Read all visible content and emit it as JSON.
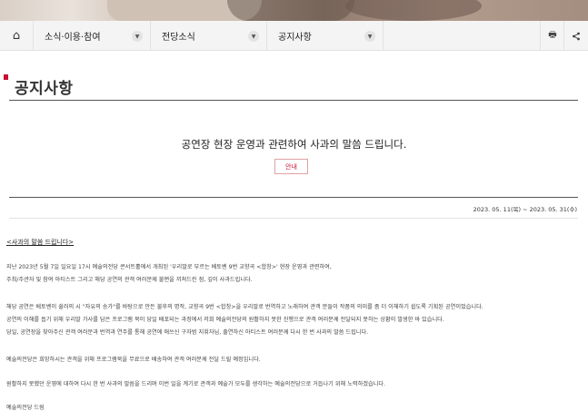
{
  "nav": {
    "home_icon": "home-icon",
    "menu1": "소식·이용·참여",
    "menu2": "전당소식",
    "menu3": "공지사항",
    "print_icon": "print-icon",
    "share_icon": "share-icon"
  },
  "page": {
    "title": "공지사항"
  },
  "notice": {
    "heading": "공연장 현장 운영과 관련하여 사과의 말씀 드립니다.",
    "category": "안내",
    "date_range": "2023. 05. 11(목) ~ 2023. 05. 31(수)",
    "body_title": "<사과의 말씀 드립니다>",
    "paragraphs": [
      "지난 2023년 5월 7일 일요일 17시 예술의전당 콘서트홀에서 개최된 '우리말로 부르는 베토벤 9번 교향곡 <합창>' 현장 운영과 관련하여,",
      "주최/주관자 및 참여 아티스트 그리고 해당 공연의 관객 여러분께 불편을 끼쳐드린 점, 깊이 사과드립니다.",
      "해당 공연은 베토벤이 쉴러의 시 \"자유의 송가\"를 바탕으로 만든 불후의 명작, 교향곡 9번 <합창>을 우리말로 번역하고 노래하여 관객 분들이 작품의 의미를 좀 더 이해하기 쉽도록 기획된 공연이었습니다.",
      "공연의 이해를 돕기 위해 우리말 가사를 담은 프로그램 북이 당일 배포되는 과정에서 저희 예술의전당의 원활하지 못한 진행으로 관객 여러분께 전달되지 못하는 상황이 발생한 바 있습니다.",
      "당일, 공연장을 찾아주신 관객 여러분과 번역과 연주를 통해 공연에 애쓰신 구자범 지휘자님, 출연하신 아티스트 여러분께 다시 한 번 사과의 말씀 드립니다.",
      "예술의전당은 희망하시는 관객을 위해 프로그램북을 무료으로 배송하여 관객 여러분께 전달 드릴 예정입니다.",
      "원활하지 못했던 운영에 대하여 다시 한 번 사과의 말씀을 드리며 이번 일을 계기로 관객과 예술가 모두를 생각하는 예술의전당으로 거듭나기 위해 노력하겠습니다.",
      "예술의전당 드림"
    ]
  },
  "colors": {
    "accent": "#c8102e",
    "nav_bg": "#f4f4f4"
  }
}
